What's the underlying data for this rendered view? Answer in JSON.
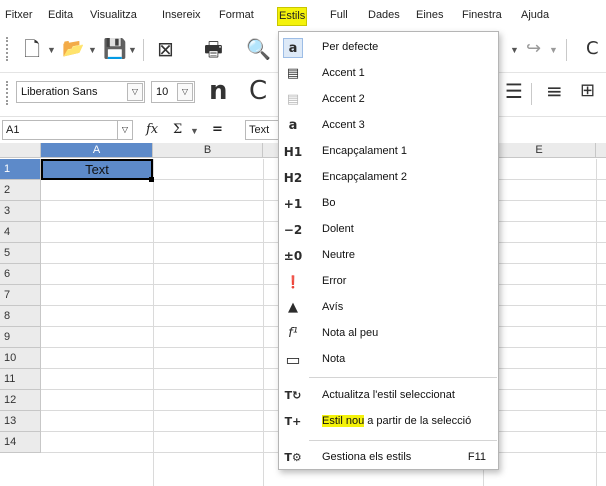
{
  "menubar": {
    "items": [
      {
        "label": "Fitxer"
      },
      {
        "label": "Edita"
      },
      {
        "label": "Visualitza"
      },
      {
        "label": "Insereix"
      },
      {
        "label": "Format"
      },
      {
        "label": "Estils"
      },
      {
        "label": "Full"
      },
      {
        "label": "Dades"
      },
      {
        "label": "Eines"
      },
      {
        "label": "Finestra"
      },
      {
        "label": "Ajuda"
      }
    ]
  },
  "toolbar2": {
    "font_name": "Liberation Sans",
    "font_size": "10"
  },
  "formulabar": {
    "cell_ref": "A1",
    "fx": "fx",
    "sigma": "Σ",
    "equals": "=",
    "content": "Text"
  },
  "grid": {
    "columns": [
      "A",
      "B",
      "E"
    ],
    "rows": [
      "1",
      "2",
      "3",
      "4",
      "5",
      "6",
      "7",
      "8",
      "9",
      "10",
      "11",
      "12",
      "13",
      "14"
    ],
    "a1_value": "Text"
  },
  "dropdown": {
    "items": [
      {
        "icon": "a",
        "label": "Per defecte"
      },
      {
        "icon": "▤",
        "label": "Accent 1"
      },
      {
        "icon": "▤",
        "label": "Accent 2"
      },
      {
        "icon": "a",
        "label": "Accent 3"
      },
      {
        "icon": "H1",
        "label": "Encapçalament 1"
      },
      {
        "icon": "H2",
        "label": "Encapçalament 2"
      },
      {
        "icon": "+1",
        "label": "Bo"
      },
      {
        "icon": "−2",
        "label": "Dolent"
      },
      {
        "icon": "±0",
        "label": "Neutre"
      },
      {
        "icon": "❗",
        "label": "Error"
      },
      {
        "icon": "▲",
        "label": "Avís"
      },
      {
        "icon": "f¹",
        "label": "Nota al peu"
      },
      {
        "icon": "▭",
        "label": "Nota"
      },
      {
        "icon": "T↻",
        "label": "Actualitza l'estil seleccionat"
      },
      {
        "icon": "T+",
        "label_hl": "Estil nou",
        "label_rest": " a partir de la selecció"
      },
      {
        "icon": "T⚙",
        "label": "Gestiona els estils",
        "accel": "F11"
      }
    ]
  },
  "colors": {
    "highlight": "#f4f20a",
    "selection": "#5d8ac9",
    "header_bg": "#ebebeb"
  }
}
